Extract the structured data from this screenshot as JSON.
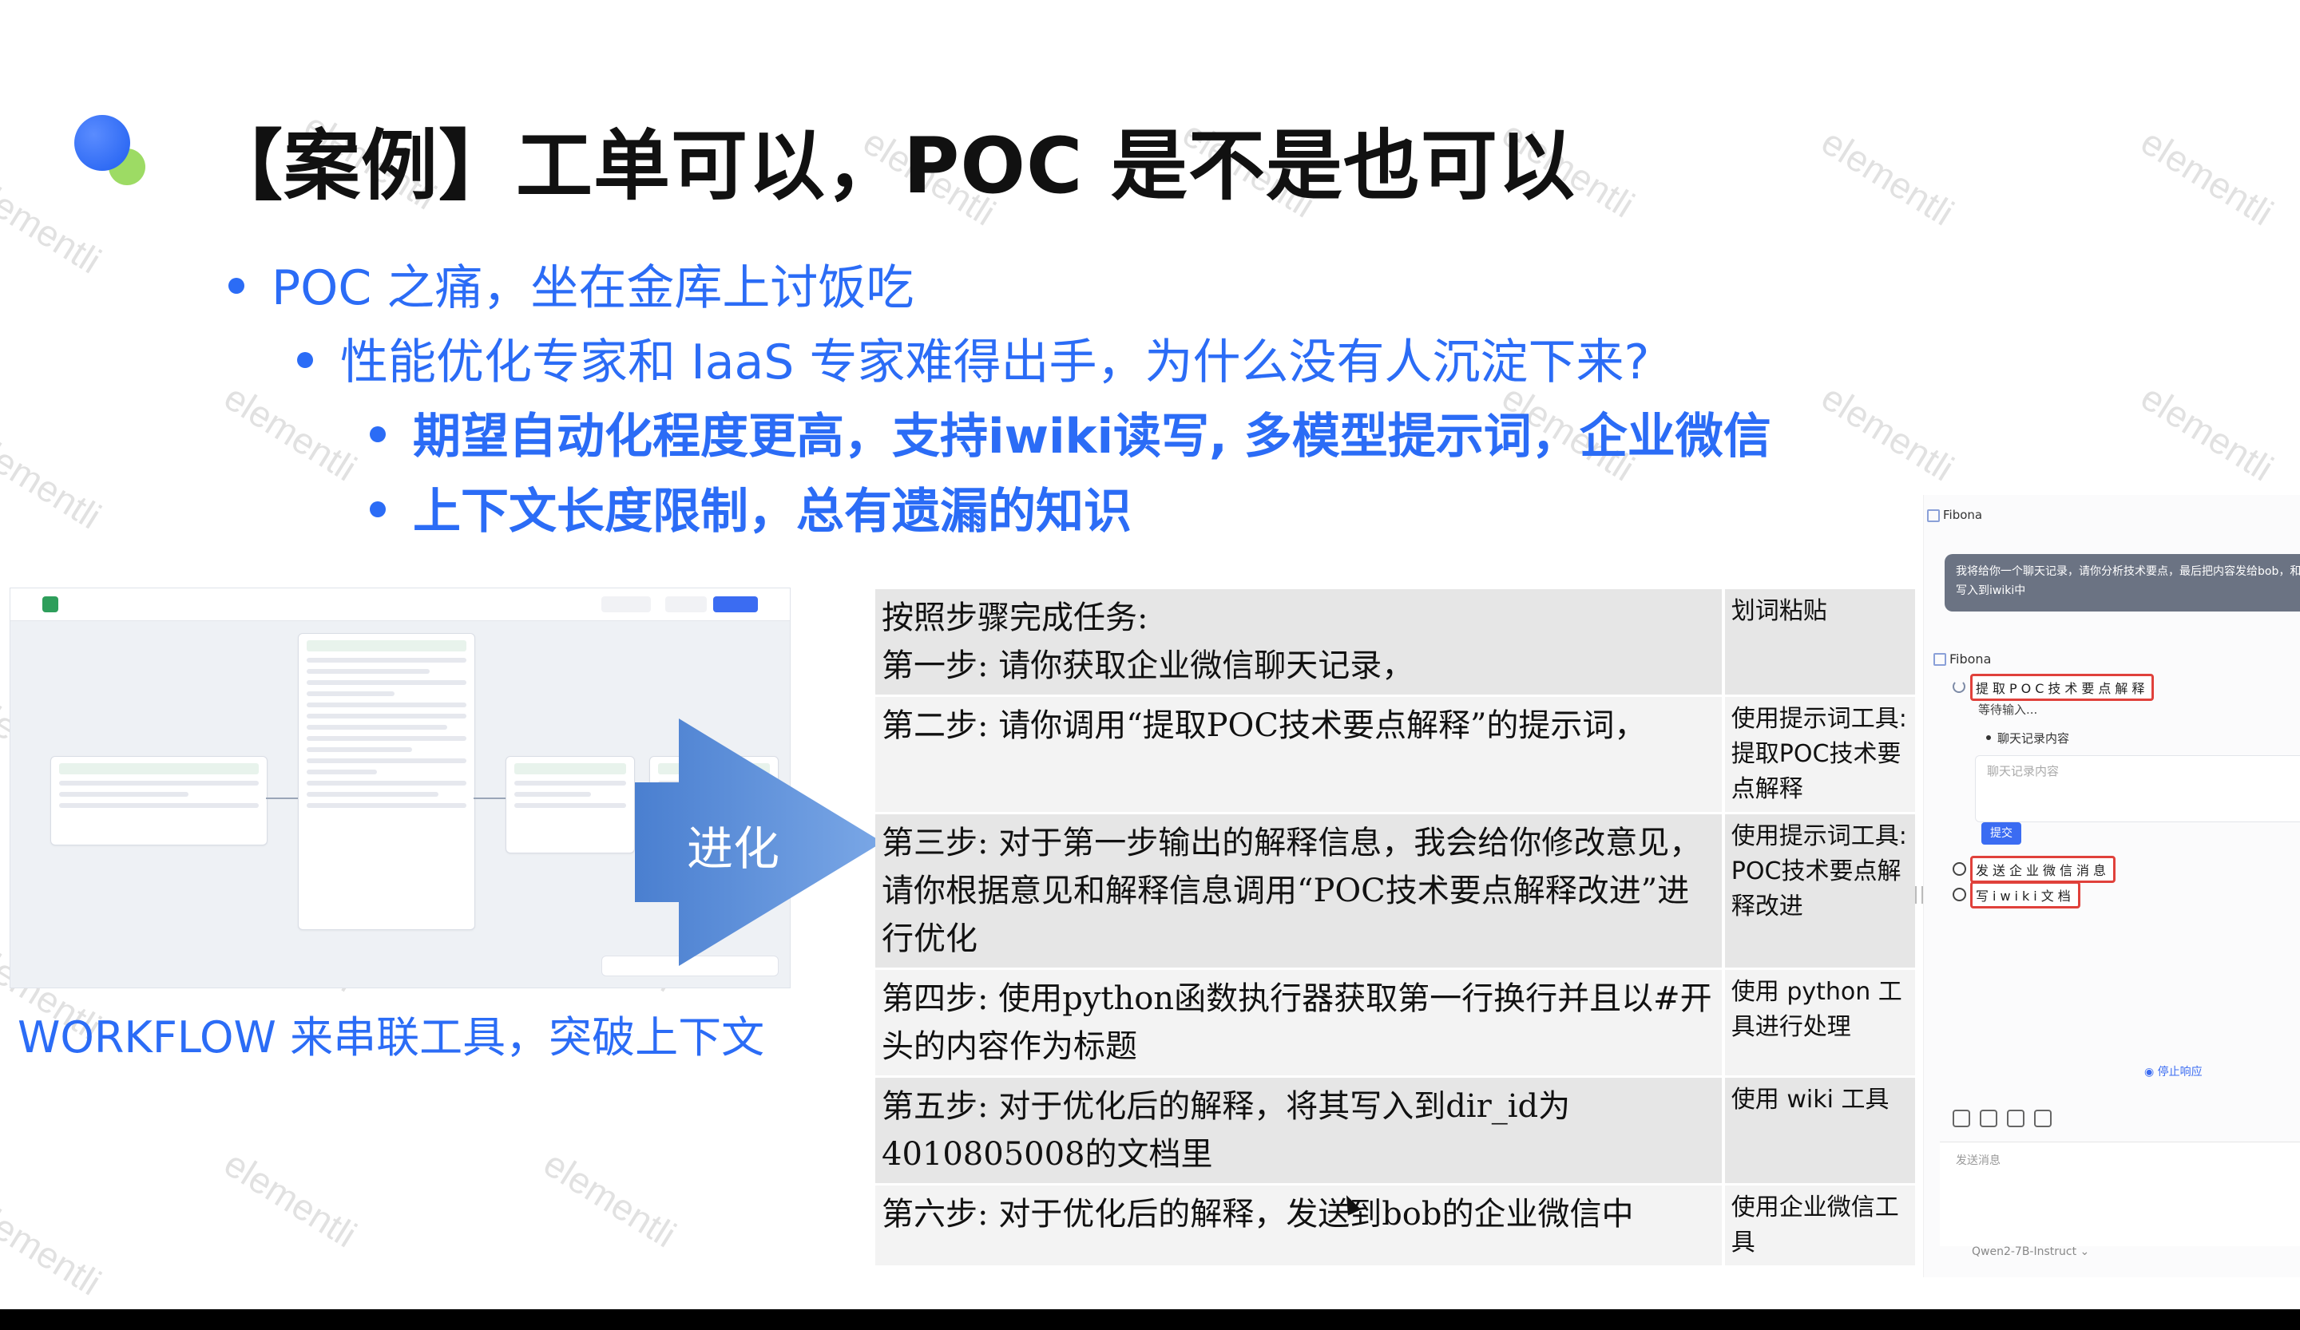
{
  "slide": {
    "title": "【案例】工单可以，POC 是不是也可以",
    "bullets": [
      "POC 之痛，坐在金库上讨饭吃",
      "性能优化专家和 IaaS 专家难得出手，为什么没有人沉淀下来?",
      "期望自动化程度更高，支持iwiki读写, 多模型提示词，企业微信",
      "上下文长度限制，总有遗漏的知识"
    ],
    "watermark": "elementli",
    "accent_color": "#2b6cf6"
  },
  "workflow": {
    "caption": "WORKFLOW 来串联工具，突破上下文"
  },
  "arrow": {
    "label": "进化",
    "color": "#5f8fd6"
  },
  "table": {
    "rows": [
      {
        "step": "按照步骤完成任务:\n第一步: 请你获取企业微信聊天记录，",
        "tool": "划词粘贴"
      },
      {
        "step": "第二步: 请你调用“提取POC技术要点解释”的提示词，",
        "tool": "使用提示词工具: 提取POC技术要点解释"
      },
      {
        "step": "第三步: 对于第一步输出的解释信息，我会给你修改意见，请你根据意见和解释信息调用“POC技术要点解释改进”进行优化",
        "tool": "使用提示词工具: POC技术要点解释改进"
      },
      {
        "step": "第四步: 使用python函数执行器获取第一行换行并且以#开头的内容作为标题",
        "tool": "使用 python 工具进行处理"
      },
      {
        "step": "第五步: 对于优化后的解释，将其写入到dir_id为4010805008的文档里",
        "tool": "使用 wiki 工具"
      },
      {
        "step": "第六步: 对于优化后的解释，发送到bob的企业微信中",
        "tool": "使用企业微信工具"
      }
    ]
  },
  "chat": {
    "panel_title": "Fibona",
    "user_message": "我将给你一个聊天记录，请你分析技术要点，最后把内容发给bob，和写入到iwiki中",
    "agent_name": "Fibona",
    "steps": [
      "提取POC技术要点解释",
      "发送企业微信消息",
      "写iwiki文档"
    ],
    "waiting_text": "等待输入...",
    "field_label": "聊天记录内容",
    "field_placeholder": "聊天记录内容",
    "submit_label": "提交",
    "stop_label": "停止响应",
    "input_placeholder": "发送消息",
    "model_name": "Qwen2-7B-Instruct"
  }
}
